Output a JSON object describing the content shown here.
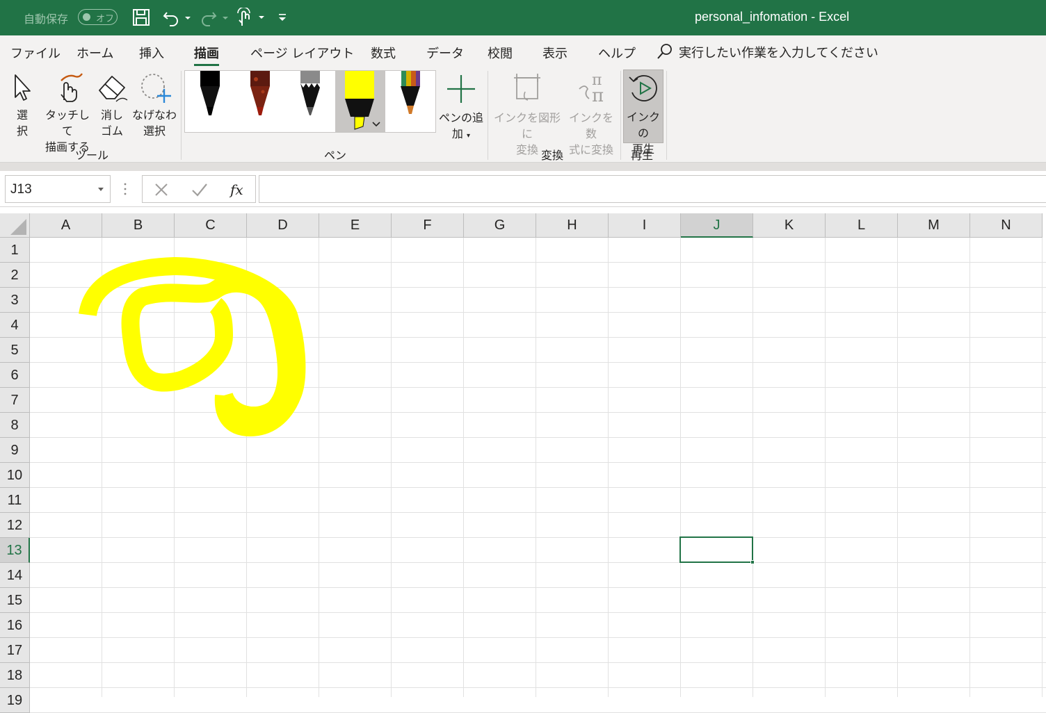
{
  "titlebar": {
    "autosave_label": "自動保存",
    "autosave_state": "オフ",
    "window_title": "personal_infomation  -  Excel"
  },
  "tabs": [
    {
      "label": "ファイル"
    },
    {
      "label": "ホーム"
    },
    {
      "label": "挿入"
    },
    {
      "label": "描画",
      "active": true
    },
    {
      "label": "ページ レイアウト"
    },
    {
      "label": "数式"
    },
    {
      "label": "データ"
    },
    {
      "label": "校閲"
    },
    {
      "label": "表示"
    },
    {
      "label": "ヘルプ"
    }
  ],
  "tellme_text": "実行したい作業を入力してください",
  "ribbon": {
    "tools": {
      "group_label": "ツール",
      "select_l1": "選",
      "select_l2": "択",
      "touch_l1": "タッチして",
      "touch_l2": "描画する",
      "eraser_l1": "消し",
      "eraser_l2": "ゴム",
      "lasso_l1": "なげなわ",
      "lasso_l2": "選択"
    },
    "pens": {
      "group_label": "ペン",
      "add_pen_l1": "ペンの追",
      "add_pen_l2": "加",
      "items": [
        {
          "name": "black-pen",
          "tip": "#000000"
        },
        {
          "name": "red-galaxy-pen",
          "tip": "#8b1a0e"
        },
        {
          "name": "pencil",
          "tip": "#888888"
        },
        {
          "name": "yellow-highlighter",
          "tip": "#ffff00",
          "selected": true
        },
        {
          "name": "rainbow-pen",
          "tip": "#d07a2a"
        }
      ]
    },
    "convert": {
      "group_label": "変換",
      "ink_shape_l1": "インクを図形に",
      "ink_shape_l2": "変換",
      "ink_math_l1": "インクを数",
      "ink_math_l2": "式に変換"
    },
    "replay": {
      "group_label": "再生",
      "ink_replay_l1": "インクの",
      "ink_replay_l2": "再生"
    }
  },
  "formula_bar": {
    "name_box": "J13",
    "formula": ""
  },
  "sheet": {
    "columns": [
      "A",
      "B",
      "C",
      "D",
      "E",
      "F",
      "G",
      "H",
      "I",
      "J",
      "K",
      "L",
      "M",
      "N"
    ],
    "rows": [
      "1",
      "2",
      "3",
      "4",
      "5",
      "6",
      "7",
      "8",
      "9",
      "10",
      "11",
      "12",
      "13",
      "14",
      "15",
      "16",
      "17",
      "18",
      "19"
    ],
    "selected_cell": "J13",
    "ink_color": "#ffff00"
  },
  "colors": {
    "accent": "#217346"
  }
}
